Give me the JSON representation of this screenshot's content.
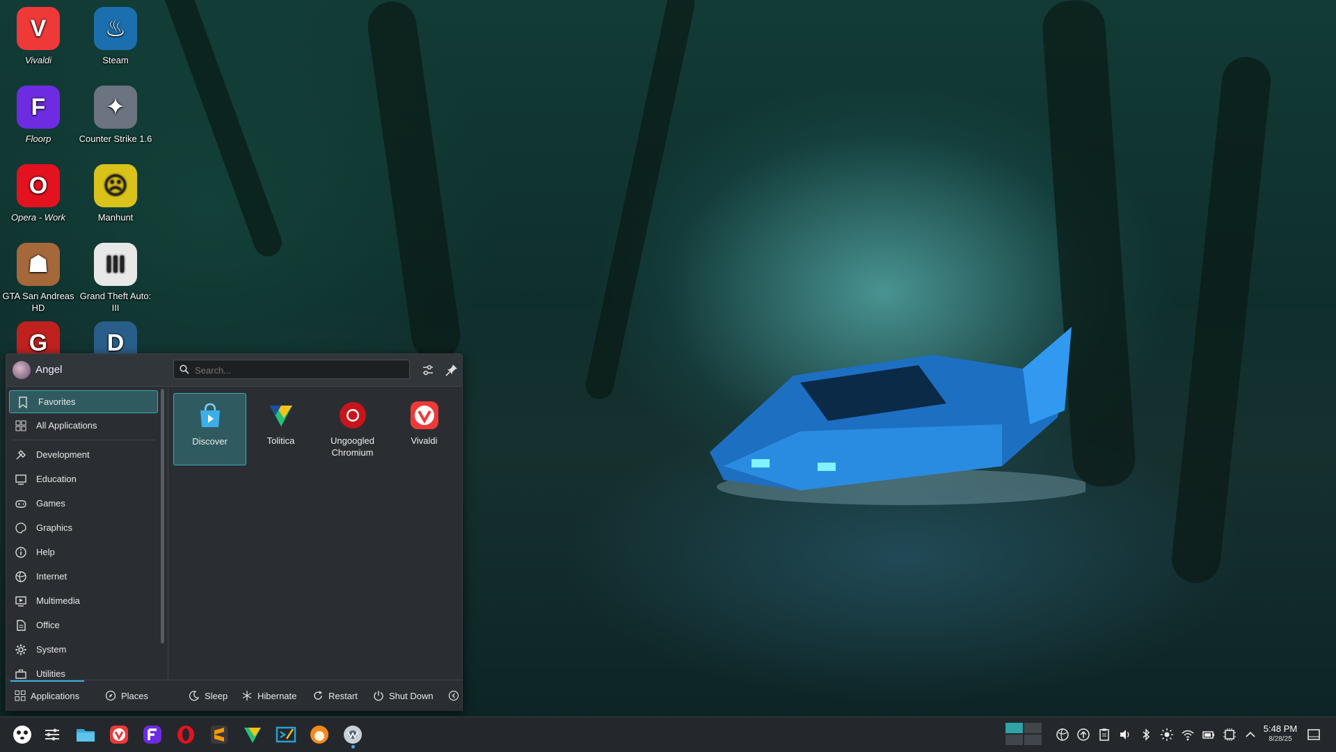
{
  "desktop": {
    "icons": [
      {
        "label": "Vivaldi",
        "italic": true,
        "color": "#ef3939",
        "glyph": "V"
      },
      {
        "label": "Steam",
        "italic": false,
        "color": "#1b6fae",
        "glyph": "♨"
      },
      {
        "label": "Floorp",
        "italic": true,
        "color": "#6d2be2",
        "glyph": "F"
      },
      {
        "label": "Counter Strike 1.6",
        "italic": false,
        "color": "#6b7480",
        "glyph": "✦"
      },
      {
        "label": "Opera - Work",
        "italic": true,
        "color": "#e4121f",
        "glyph": "O"
      },
      {
        "label": "Manhunt",
        "italic": false,
        "color": "#d9c21a",
        "glyph": "☹"
      },
      {
        "label": "GTA San Andreas HD",
        "italic": false,
        "color": "#a5683a",
        "glyph": "☗"
      },
      {
        "label": "Grand Theft Auto: III",
        "italic": false,
        "color": "#e8e8e8",
        "glyph": "III"
      },
      {
        "label": "",
        "italic": false,
        "color": "#c0211e",
        "glyph": "G"
      },
      {
        "label": "",
        "italic": false,
        "color": "#2a5e8a",
        "glyph": "D"
      }
    ]
  },
  "launcher": {
    "user_name": "Angel",
    "search_placeholder": "Search...",
    "categories": [
      {
        "label": "Favorites",
        "icon": "bookmark-icon",
        "selected": true
      },
      {
        "label": "All Applications",
        "icon": "grid-icon",
        "selected": false
      },
      {
        "label": "Development",
        "icon": "hammer-icon",
        "selected": false
      },
      {
        "label": "Education",
        "icon": "monitor-icon",
        "selected": false
      },
      {
        "label": "Games",
        "icon": "gamepad-icon",
        "selected": false
      },
      {
        "label": "Graphics",
        "icon": "palette-icon",
        "selected": false
      },
      {
        "label": "Help",
        "icon": "info-icon",
        "selected": false
      },
      {
        "label": "Internet",
        "icon": "globe-icon",
        "selected": false
      },
      {
        "label": "Multimedia",
        "icon": "media-icon",
        "selected": false
      },
      {
        "label": "Office",
        "icon": "document-icon",
        "selected": false
      },
      {
        "label": "System",
        "icon": "gear-icon",
        "selected": false
      },
      {
        "label": "Utilities",
        "icon": "briefcase-icon",
        "selected": false
      }
    ],
    "favorites": [
      {
        "label": "Discover",
        "icon": "discover-icon",
        "selected": true
      },
      {
        "label": "Tolitica",
        "icon": "tolitica-icon",
        "selected": false
      },
      {
        "label": "Ungoogled Chromium",
        "icon": "chromium-icon",
        "selected": false
      },
      {
        "label": "Vivaldi",
        "icon": "vivaldi-icon",
        "selected": false
      }
    ],
    "footer": {
      "applications": "Applications",
      "places": "Places",
      "sleep": "Sleep",
      "hibernate": "Hibernate",
      "restart": "Restart",
      "shutdown": "Shut Down"
    }
  },
  "taskbar": {
    "apps": [
      "launcher-icon",
      "settings-icon",
      "file-manager-icon",
      "vivaldi-icon",
      "floorp-icon",
      "opera-icon",
      "sublime-icon",
      "tolitica-icon",
      "vscode-icon",
      "waterfox-icon",
      "chromium-icon"
    ],
    "clock": {
      "time": "5:48 PM",
      "date": "8/28/25"
    }
  },
  "colors": {
    "accent": "#3daee9",
    "selection": "#2f5b60",
    "panel": "#2a2e32"
  }
}
